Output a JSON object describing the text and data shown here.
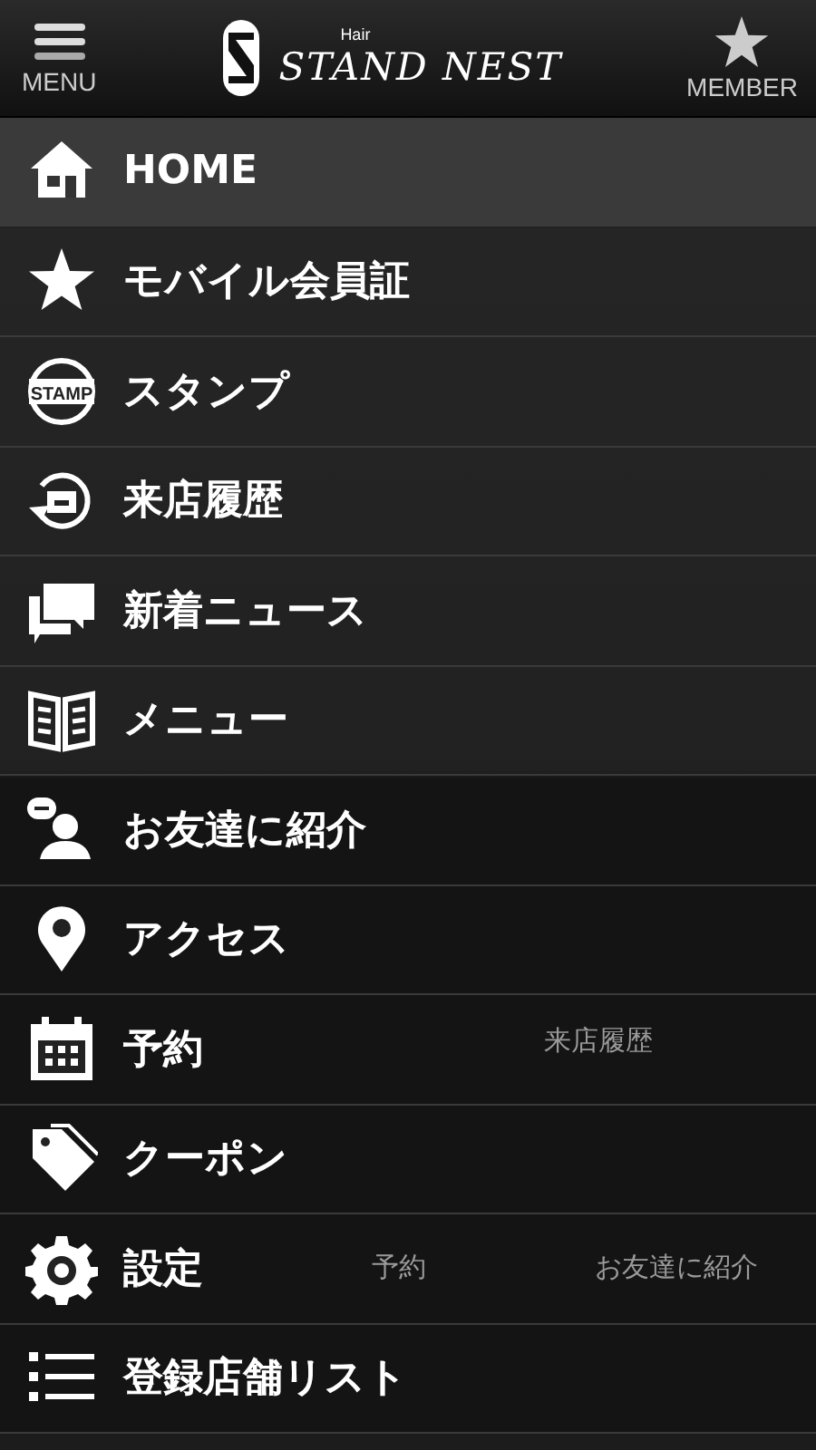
{
  "header": {
    "menu_label": "MENU",
    "logo_small": "Hair",
    "logo": "STAND NEST",
    "member_label": "MEMBER"
  },
  "background": {
    "labels": [
      "来店履歴",
      "予約",
      "お友達に紹介"
    ]
  },
  "menu": [
    {
      "label": "HOME",
      "selected": true
    },
    {
      "label": "モバイル会員証",
      "selected": false
    },
    {
      "label": "スタンプ",
      "selected": false,
      "icon_text": "STAMP"
    },
    {
      "label": "来店履歴",
      "selected": false
    },
    {
      "label": "新着ニュース",
      "selected": false
    },
    {
      "label": "メニュー",
      "selected": false
    },
    {
      "label": "お友達に紹介",
      "selected": false
    },
    {
      "label": "アクセス",
      "selected": false
    },
    {
      "label": "予約",
      "selected": false
    },
    {
      "label": "クーポン",
      "selected": false
    },
    {
      "label": "設定",
      "selected": false
    },
    {
      "label": "登録店舗リスト",
      "selected": false
    }
  ]
}
